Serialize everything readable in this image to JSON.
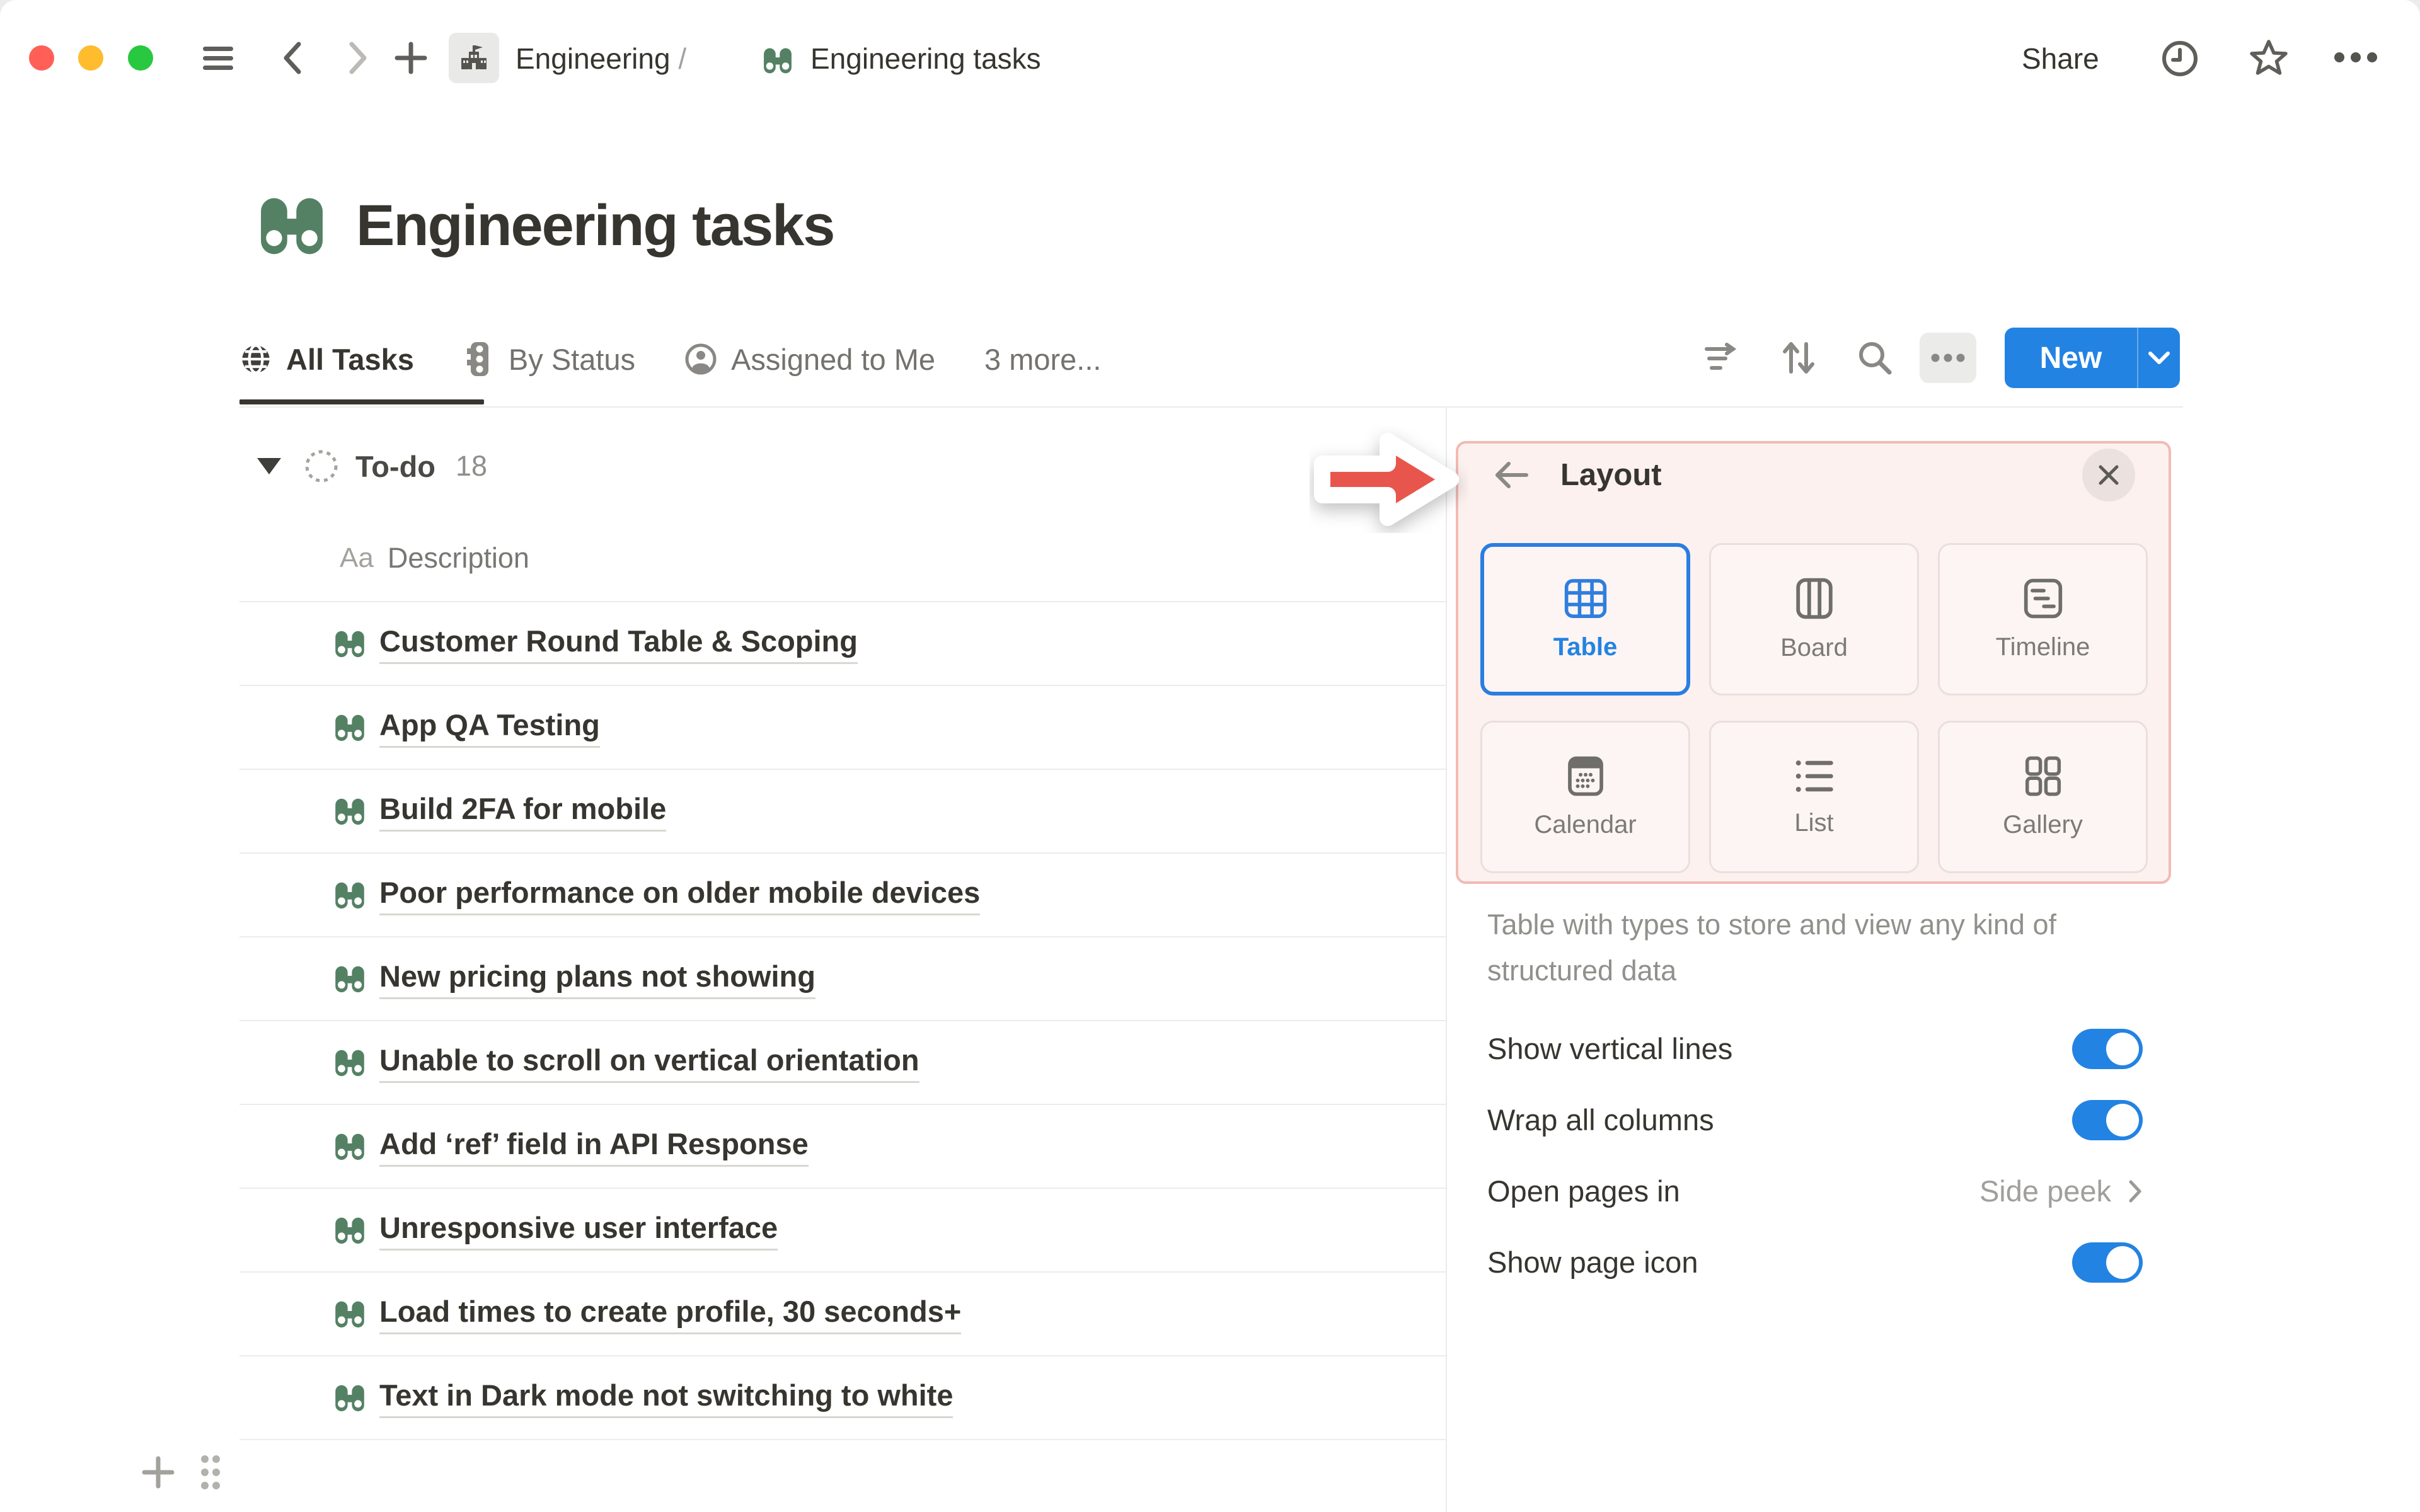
{
  "topbar": {
    "breadcrumb": {
      "space": "Engineering",
      "separator": "/",
      "page": "Engineering tasks"
    },
    "share_label": "Share"
  },
  "page": {
    "title": "Engineering tasks"
  },
  "tabs": [
    {
      "label": "All Tasks",
      "active": true
    },
    {
      "label": "By Status",
      "active": false
    },
    {
      "label": "Assigned to Me",
      "active": false
    },
    {
      "label": "3 more...",
      "active": false
    }
  ],
  "toolbar": {
    "new_label": "New"
  },
  "table": {
    "group": {
      "name": "To-do",
      "count": "18"
    },
    "column_header": {
      "icon_label": "Aa",
      "label": "Description"
    },
    "rows": [
      "Customer Round Table & Scoping",
      "App QA Testing",
      "Build 2FA for mobile",
      "Poor performance on older mobile devices",
      "New pricing plans not showing",
      "Unable to scroll on vertical orientation",
      "Add ‘ref’ field in API Response",
      "Unresponsive user interface",
      "Load times to create profile, 30 seconds+",
      "Text in Dark mode not switching to white"
    ]
  },
  "panel": {
    "title": "Layout",
    "options": [
      {
        "label": "Table",
        "selected": true
      },
      {
        "label": "Board",
        "selected": false
      },
      {
        "label": "Timeline",
        "selected": false
      },
      {
        "label": "Calendar",
        "selected": false
      },
      {
        "label": "List",
        "selected": false
      },
      {
        "label": "Gallery",
        "selected": false
      }
    ],
    "description": "Table with types to store and view any kind of structured data",
    "settings": [
      {
        "label": "Show vertical lines",
        "type": "toggle",
        "value": true
      },
      {
        "label": "Wrap all columns",
        "type": "toggle",
        "value": true
      },
      {
        "label": "Open pages in",
        "type": "value",
        "value": "Side peek"
      },
      {
        "label": "Show page icon",
        "type": "toggle",
        "value": true
      }
    ]
  },
  "colors": {
    "accent_blue": "#2383e2",
    "icon_green": "#548164",
    "highlight_pink": "#f2bab4",
    "arrow_red": "#e8554d"
  }
}
